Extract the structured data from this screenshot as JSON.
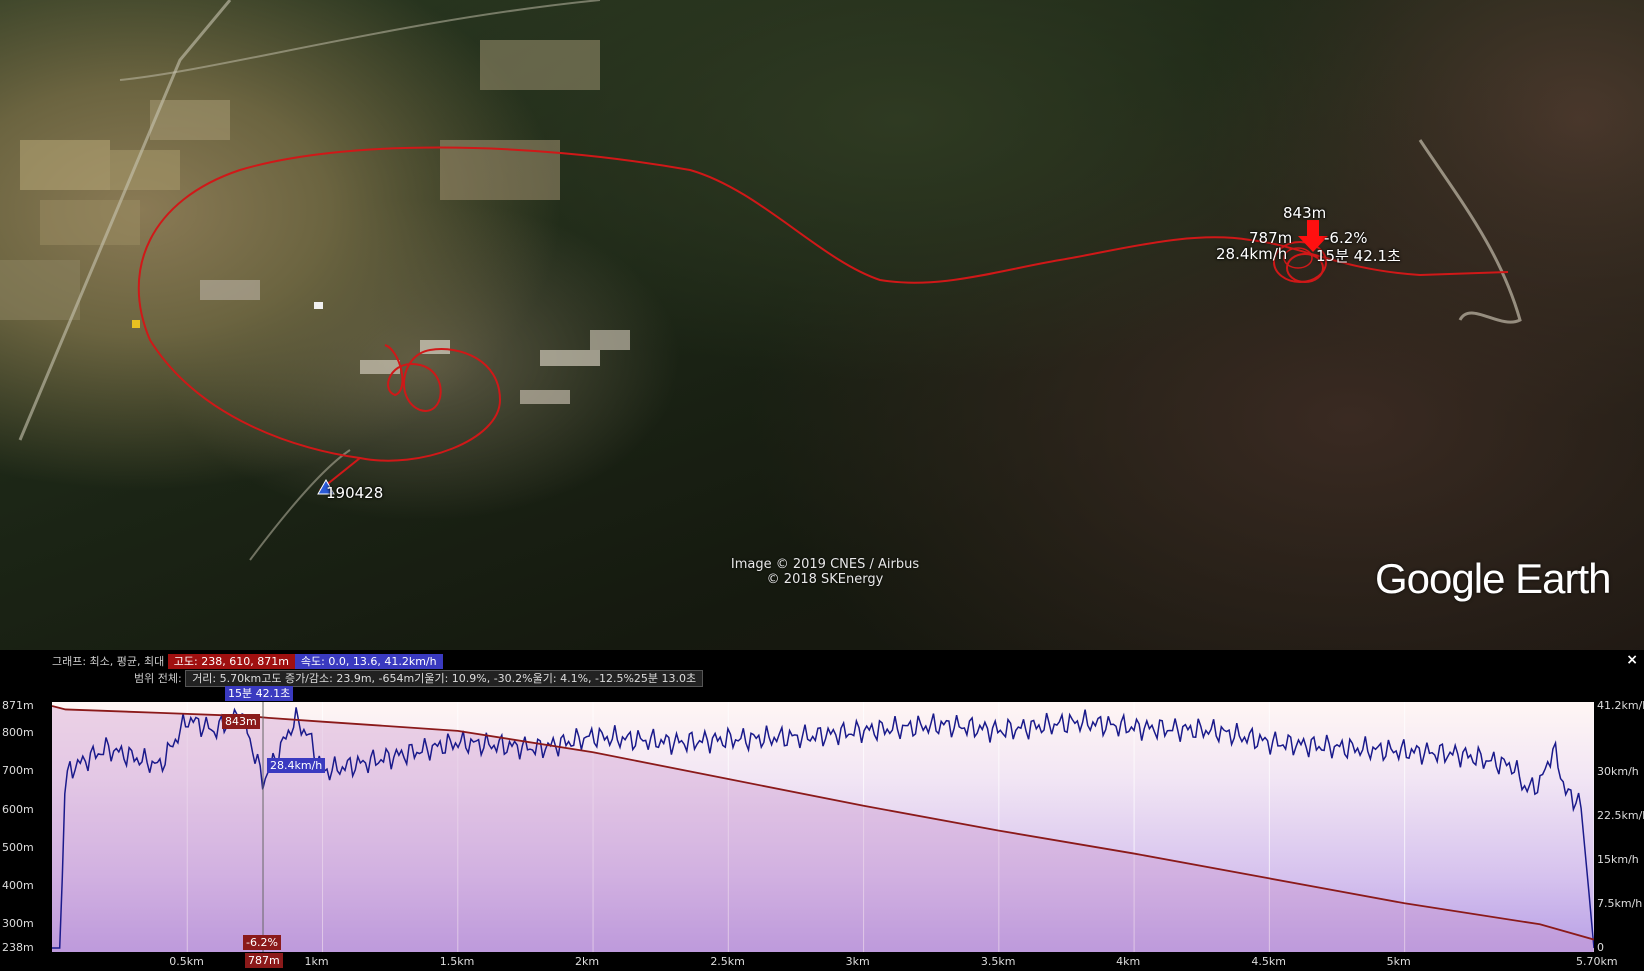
{
  "map": {
    "track_label": "190428",
    "cursor": {
      "altitude": "843m",
      "ground_alt": "787m",
      "grade": "-6.2%",
      "speed": "28.4km/h",
      "time": "15분 42.1초"
    },
    "copyright_line1": "Image © 2019 CNES / Airbus",
    "copyright_line2": "© 2018 SKEnergy",
    "logo": "Google Earth",
    "track_color": "#d01818"
  },
  "panel": {
    "graph_prefix": "그래프: 최소, 평균, 최대",
    "altitude_box": "고도: 238, 610, 871m",
    "speed_box": "속도: 0.0, 13.6, 41.2km/h",
    "range_prefix": "범위 전체:",
    "range_stats": "거리: 5.70km고도 증가/감소: 23.9m, -654m기울기: 10.9%, -30.2%울기: 4.1%, -12.5%25분 13.0초",
    "close": "×",
    "colors": {
      "altitude": "#8b1a1a",
      "speed": "#1a1a8b",
      "altitude_box": "#a01010",
      "speed_box": "#3a3ac0"
    }
  },
  "chart_data": {
    "type": "line",
    "x_unit": "km",
    "xlim": [
      0,
      5.7
    ],
    "left_ylim": [
      238,
      871
    ],
    "right_ylim": [
      0,
      41.2
    ],
    "x_ticks": [
      "0.5km",
      "1km",
      "1.5km",
      "2km",
      "2.5km",
      "3km",
      "3.5km",
      "4km",
      "4.5km",
      "5km",
      "5.70km"
    ],
    "left_ticks": [
      "871m",
      "800m",
      "700m",
      "600m",
      "500m",
      "400m",
      "300m",
      "238m"
    ],
    "right_ticks": [
      "41.2km/h",
      "30km/h",
      "22.5km/h",
      "15km/h",
      "7.5km/h",
      "0"
    ],
    "series": [
      {
        "name": "고도",
        "x": [
          0,
          0.05,
          0.4,
          0.7,
          0.75,
          0.8,
          1.0,
          1.5,
          2.0,
          2.5,
          3.0,
          3.5,
          4.0,
          4.5,
          5.0,
          5.5,
          5.7
        ],
        "values": [
          871,
          862,
          853,
          845,
          843,
          840,
          830,
          806,
          750,
          680,
          610,
          545,
          485,
          420,
          355,
          300,
          260
        ]
      },
      {
        "name": "속도",
        "x": [
          0,
          0.03,
          0.05,
          0.2,
          0.4,
          0.5,
          0.6,
          0.7,
          0.78,
          0.8,
          0.9,
          0.95,
          1.0,
          1.1,
          1.3,
          1.5,
          1.8,
          2.0,
          2.3,
          2.5,
          2.8,
          3.0,
          3.3,
          3.5,
          3.8,
          4.0,
          4.3,
          4.5,
          4.8,
          5.0,
          5.2,
          5.3,
          5.4,
          5.45,
          5.5,
          5.55,
          5.6,
          5.65,
          5.7
        ],
        "values": [
          0,
          0,
          30,
          34,
          31,
          39,
          37,
          40,
          28.4,
          30,
          39,
          36,
          30,
          31,
          33,
          35,
          34,
          36,
          35,
          35.5,
          36,
          37,
          38,
          37,
          38.5,
          37.5,
          37,
          35,
          34,
          33.5,
          33,
          32,
          31,
          27,
          28,
          34,
          26,
          25,
          0
        ]
      }
    ],
    "cursor": {
      "x": 0.78,
      "altitude": "843m",
      "ground": "787m",
      "grade": "-6.2%",
      "speed": "28.4km/h",
      "time": "15분 42.1초"
    }
  }
}
